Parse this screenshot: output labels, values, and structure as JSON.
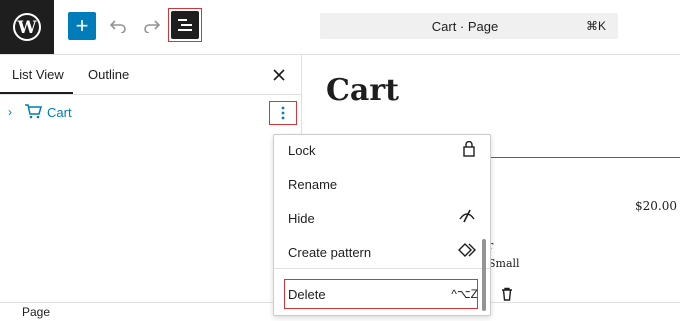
{
  "toolbar": {
    "document_title": "Cart · Page",
    "shortcut": "⌘K"
  },
  "panel": {
    "tabs": [
      "List View",
      "Outline"
    ],
    "tree": [
      {
        "label": "Cart"
      }
    ]
  },
  "context_menu": {
    "items": [
      {
        "label": "Lock",
        "icon": "lock-icon"
      },
      {
        "label": "Rename"
      },
      {
        "label": "Hide",
        "icon": "hide-icon"
      },
      {
        "label": "Create pattern",
        "icon": "pattern-icon"
      },
      {
        "label": "Delete",
        "shortcut": "^⌥Z"
      }
    ]
  },
  "canvas": {
    "page_heading": "Cart",
    "price": "$20.00",
    "item_fragment": "r",
    "item_variant": "Small"
  },
  "footer": {
    "breadcrumb": "Page"
  },
  "colors": {
    "accent": "#007cba",
    "highlight": "#d63638",
    "dark": "#1e1e1e"
  }
}
